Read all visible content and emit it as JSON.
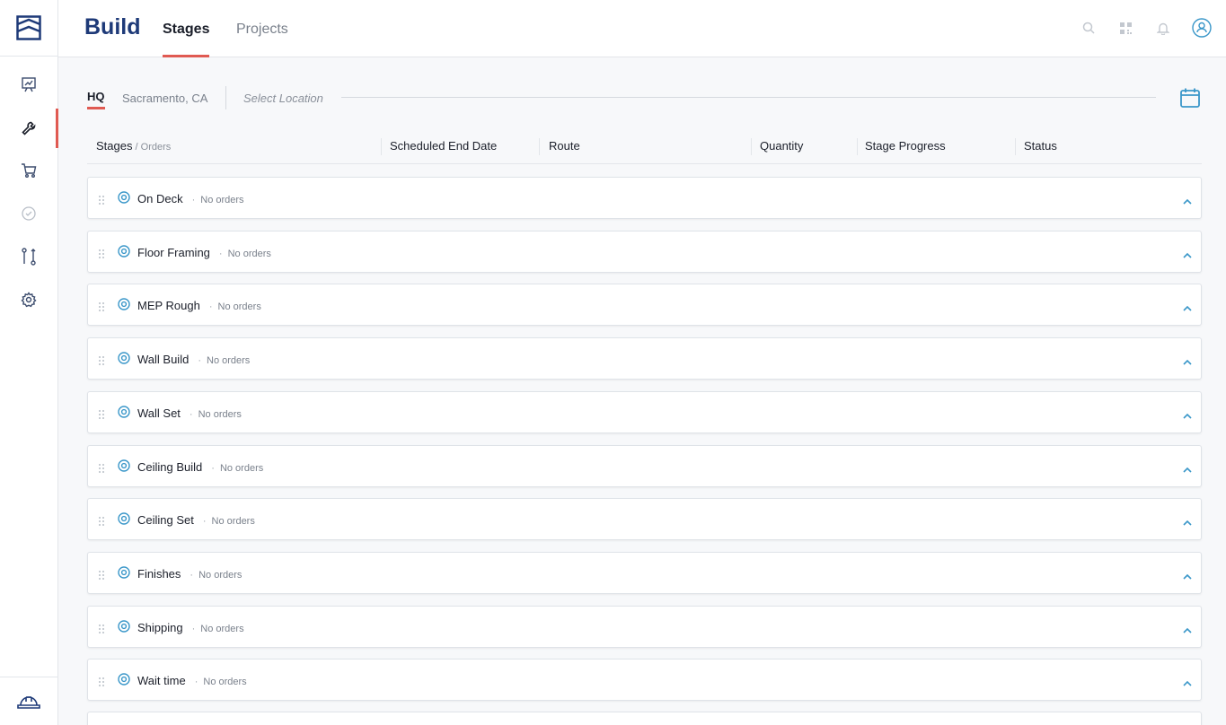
{
  "header": {
    "app_title": "Build",
    "tabs": [
      {
        "label": "Stages",
        "active": true
      },
      {
        "label": "Projects",
        "active": false
      }
    ],
    "icons": [
      "search-icon",
      "qr-code-icon",
      "bell-icon",
      "user-avatar-icon"
    ]
  },
  "sidebar": {
    "items": [
      {
        "icon": "presentation-chart-icon",
        "active": false
      },
      {
        "icon": "wrench-icon",
        "active": true
      },
      {
        "icon": "cart-icon",
        "active": false
      },
      {
        "icon": "check-circle-icon",
        "active": false
      },
      {
        "icon": "route-icon",
        "active": false
      },
      {
        "icon": "gear-icon",
        "active": false
      }
    ],
    "bottom_icon": "hard-hat-icon"
  },
  "location": {
    "hq": "HQ",
    "city": "Sacramento, CA",
    "select_placeholder": "Select Location"
  },
  "columns": {
    "stages": "Stages",
    "orders_sub": " / Orders",
    "scheduled_end": "Scheduled End Date",
    "route": "Route",
    "quantity": "Quantity",
    "stage_progress": "Stage Progress",
    "status": "Status"
  },
  "stages": [
    {
      "name": "On Deck",
      "orders": "No orders"
    },
    {
      "name": "Floor Framing",
      "orders": "No orders"
    },
    {
      "name": "MEP Rough",
      "orders": "No orders"
    },
    {
      "name": "Wall Build",
      "orders": "No orders"
    },
    {
      "name": "Wall Set",
      "orders": "No orders"
    },
    {
      "name": "Ceiling Build",
      "orders": "No orders"
    },
    {
      "name": "Ceiling Set",
      "orders": "No orders"
    },
    {
      "name": "Finishes",
      "orders": "No orders"
    },
    {
      "name": "Shipping",
      "orders": "No orders"
    },
    {
      "name": "Wait time",
      "orders": "No orders"
    }
  ],
  "colors": {
    "brand": "#1e3a78",
    "accent": "#e05a52",
    "icon_blue": "#3a97c9"
  }
}
